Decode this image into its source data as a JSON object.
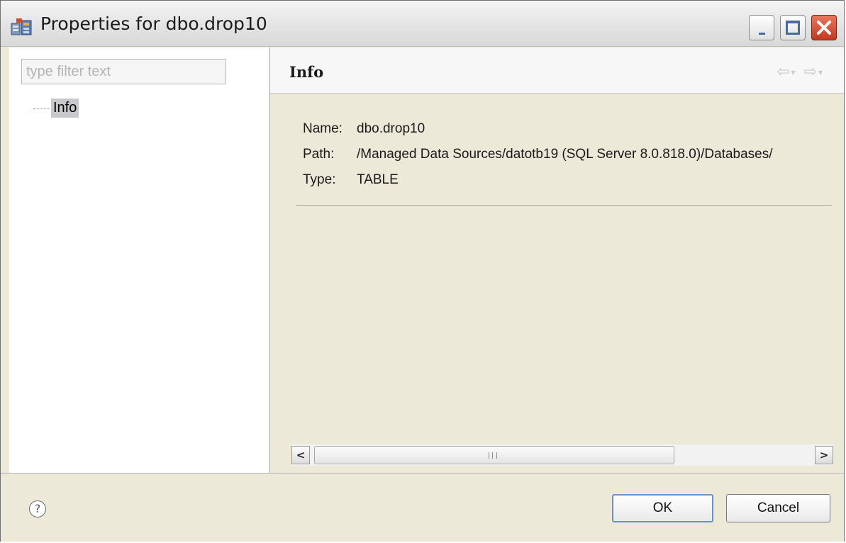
{
  "window": {
    "title": "Properties for dbo.drop10"
  },
  "sidebar": {
    "filter_placeholder": "type filter text",
    "tree": [
      {
        "label": "Info",
        "selected": true
      }
    ]
  },
  "main": {
    "header_title": "Info",
    "nav_back_icon": "arrow-left-icon",
    "nav_forward_icon": "arrow-right-icon",
    "fields": {
      "name_label": "Name:",
      "name_value": "dbo.drop10",
      "path_label": "Path:",
      "path_value": "/Managed Data Sources/datotb19 (SQL Server 8.0.818.0)/Databases/",
      "type_label": "Type:",
      "type_value": "TABLE"
    }
  },
  "footer": {
    "help_glyph": "?",
    "ok_label": "OK",
    "cancel_label": "Cancel"
  }
}
